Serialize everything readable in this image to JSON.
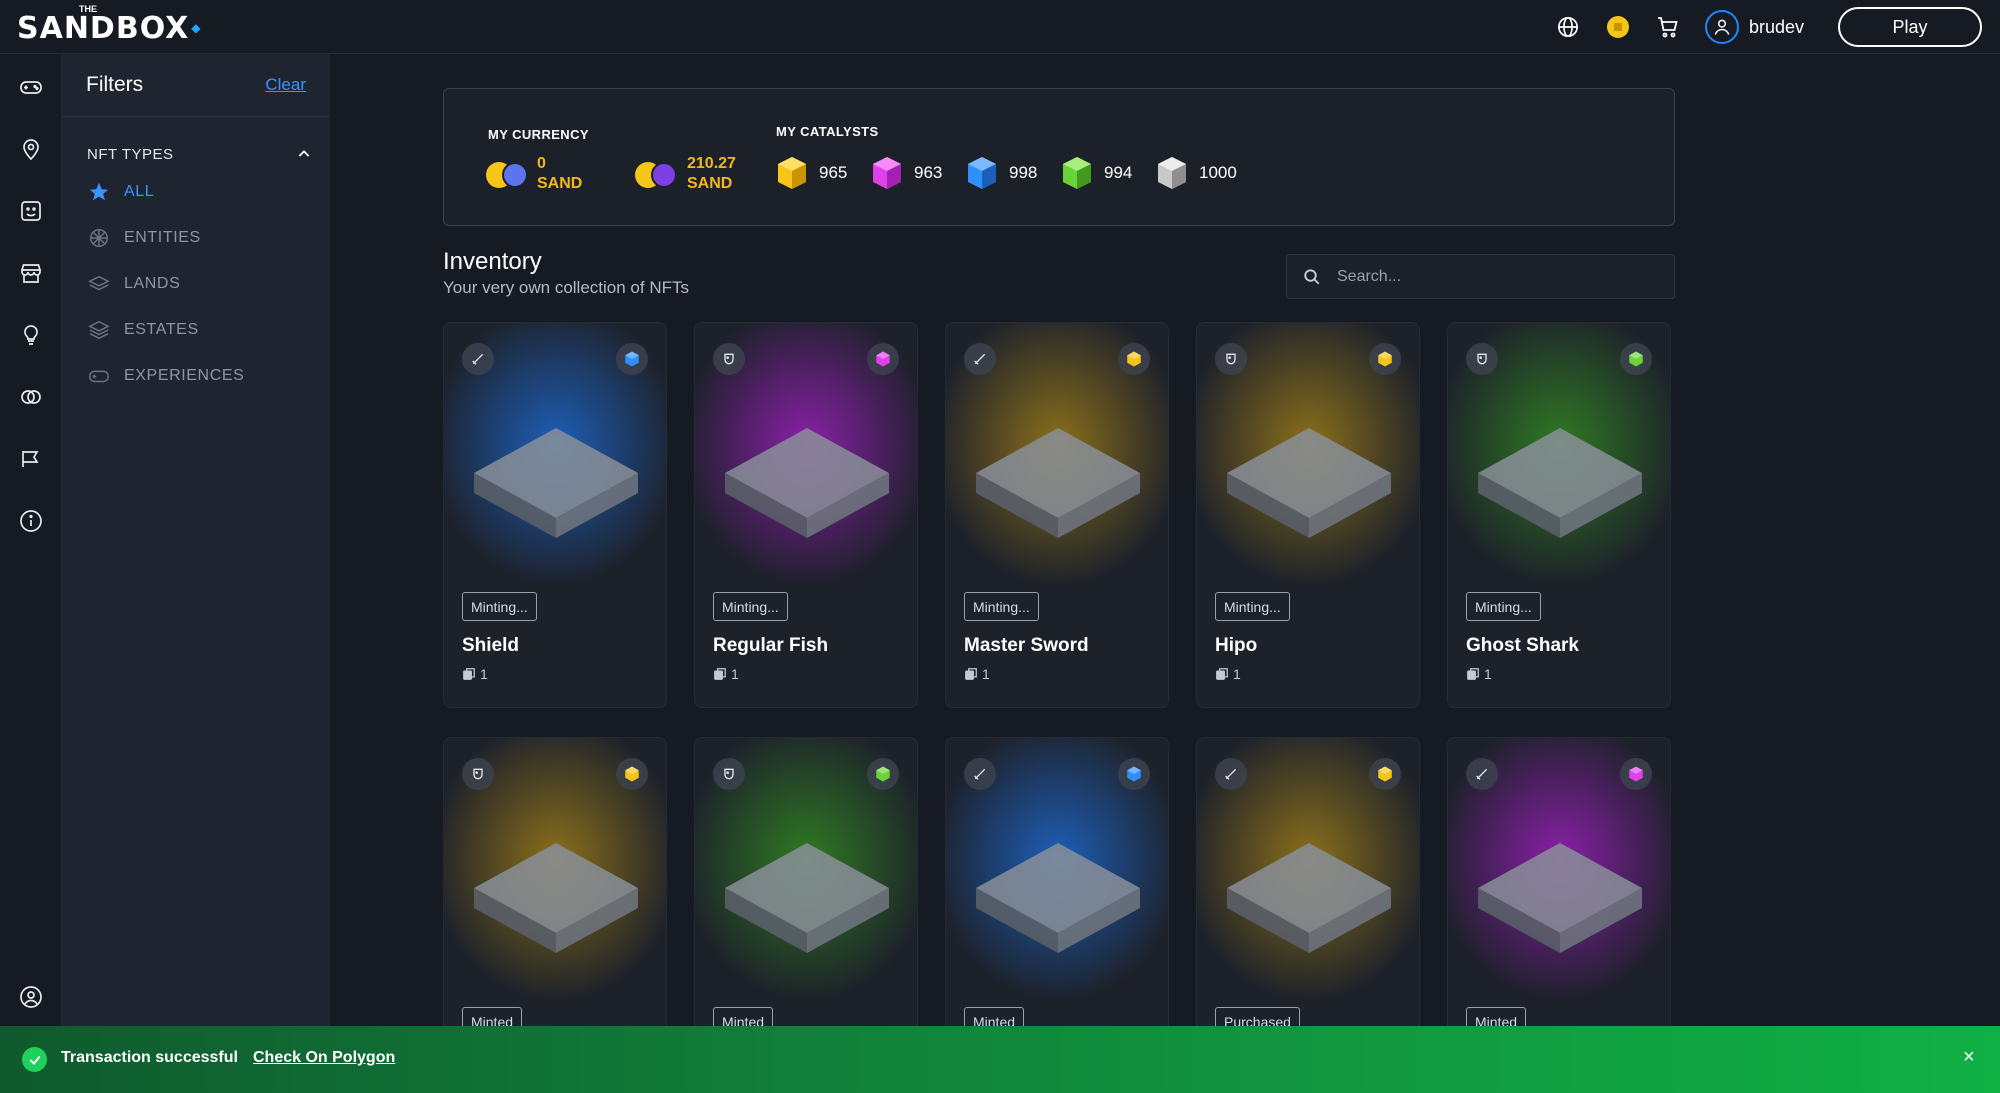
{
  "topbar": {
    "logo_small": "THE",
    "logo_text": "SANDBOX",
    "username": "brudev",
    "play_label": "Play"
  },
  "filters": {
    "title": "Filters",
    "clear_label": "Clear",
    "section_title": "NFT TYPES",
    "items": [
      {
        "label": "ALL",
        "icon": "star-icon",
        "active": true
      },
      {
        "label": "ENTITIES",
        "icon": "entities-icon",
        "active": false
      },
      {
        "label": "LANDS",
        "icon": "lands-icon",
        "active": false
      },
      {
        "label": "ESTATES",
        "icon": "estates-icon",
        "active": false
      },
      {
        "label": "EXPERIENCES",
        "icon": "experiences-icon",
        "active": false
      }
    ]
  },
  "currency": {
    "title": "MY CURRENCY",
    "balances": [
      {
        "amount": "0",
        "unit": "SAND",
        "network": "ethereum"
      },
      {
        "amount": "210.27",
        "unit": "SAND",
        "network": "polygon"
      }
    ],
    "catalysts_title": "MY CATALYSTS",
    "catalysts": [
      {
        "tier": "legendary",
        "color": "#f5c518",
        "count": "965"
      },
      {
        "tier": "epic",
        "color": "#e040e8",
        "count": "963"
      },
      {
        "tier": "rare",
        "color": "#2f8fff",
        "count": "998"
      },
      {
        "tier": "uncommon",
        "color": "#6ad33a",
        "count": "994"
      },
      {
        "tier": "common",
        "color": "#c9c9c9",
        "count": "1000"
      }
    ]
  },
  "inventory": {
    "title": "Inventory",
    "subtitle": "Your very own collection of NFTs",
    "search_placeholder": "Search..."
  },
  "cards": [
    {
      "name": "Shield",
      "status": "Minting...",
      "count": "1",
      "type": "equipment",
      "catalyst": "#2f8fff",
      "glow": "#1d5fb8"
    },
    {
      "name": "Regular Fish",
      "status": "Minting...",
      "count": "1",
      "type": "entity",
      "catalyst": "#e040e8",
      "glow": "#8a1fa8"
    },
    {
      "name": "Master Sword",
      "status": "Minting...",
      "count": "1",
      "type": "equipment",
      "catalyst": "#f5c518",
      "glow": "#8a6f1a"
    },
    {
      "name": "Hipo",
      "status": "Minting...",
      "count": "1",
      "type": "entity",
      "catalyst": "#f5c518",
      "glow": "#8a6f1a"
    },
    {
      "name": "Ghost Shark",
      "status": "Minting...",
      "count": "1",
      "type": "entity",
      "catalyst": "#6ad33a",
      "glow": "#2f7a22"
    },
    {
      "name": "",
      "status": "Minted",
      "count": "",
      "type": "entity",
      "catalyst": "#f5c518",
      "glow": "#8a6f1a"
    },
    {
      "name": "",
      "status": "Minted",
      "count": "",
      "type": "entity",
      "catalyst": "#6ad33a",
      "glow": "#2f7a22"
    },
    {
      "name": "",
      "status": "Minted",
      "count": "",
      "type": "equipment",
      "catalyst": "#2f8fff",
      "glow": "#1d5fb8"
    },
    {
      "name": "",
      "status": "Purchased",
      "count": "",
      "type": "equipment",
      "catalyst": "#f5c518",
      "glow": "#8a6f1a"
    },
    {
      "name": "",
      "status": "Minted",
      "count": "",
      "type": "equipment",
      "catalyst": "#e040e8",
      "glow": "#8a1fa8"
    }
  ],
  "toast": {
    "message": "Transaction successful",
    "link_label": "Check On Polygon",
    "close_label": "×"
  }
}
